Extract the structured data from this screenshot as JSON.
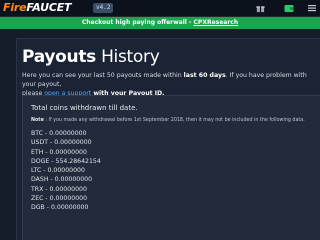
{
  "nav": {
    "logo_fire": "Fire",
    "logo_faucet": "FAUCET",
    "version": "v4.2"
  },
  "promo": {
    "text": "Checkout high paying offerwall - ",
    "link": "CPXResearch"
  },
  "page": {
    "title_bold": "Payouts",
    "title_rest": " History",
    "intro_1": "Here you can see your last 50 payouts made within ",
    "intro_bold": "last 60 days",
    "intro_2": ". If you have problem with your payout,",
    "intro_3": "please ",
    "intro_link": "open a support",
    "intro_4": " with your Payout ID."
  },
  "panel": {
    "heading": "Total coins withdrawn till date.",
    "note_label": "Note",
    "note_text": " : If you made any withdrawal before 1st September 2018, then it may not be included in the following data.",
    "coins": [
      {
        "name": "BTC",
        "amount": "0.00000000"
      },
      {
        "name": "USDT",
        "amount": "0.00000000"
      },
      {
        "name": "ETH",
        "amount": "0.00000000"
      },
      {
        "name": "DOGE",
        "amount": "554.28642154"
      },
      {
        "name": "LTC",
        "amount": "0.00000000"
      },
      {
        "name": "DASH",
        "amount": "0.00000000"
      },
      {
        "name": "TRX",
        "amount": "0.00000000"
      },
      {
        "name": "ZEC",
        "amount": "0.00000000"
      },
      {
        "name": "DGB",
        "amount": "0.00000000"
      }
    ]
  },
  "colors": {
    "accent_green": "#1ea34e",
    "brand_orange": "#ff8a1e",
    "link_blue": "#4ea8ff"
  }
}
